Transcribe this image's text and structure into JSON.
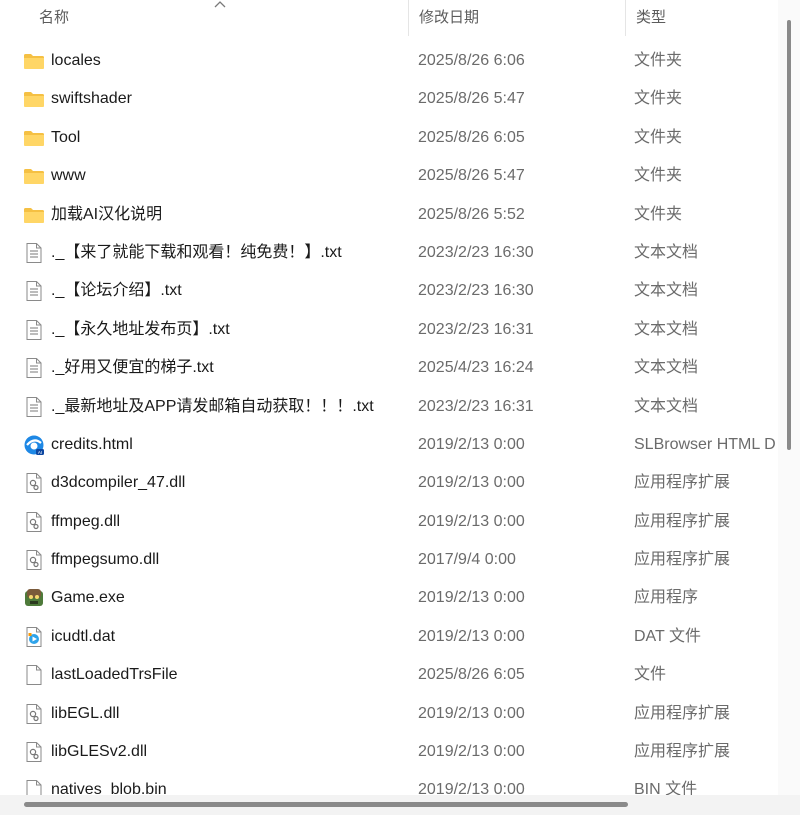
{
  "header": {
    "name_label": "名称",
    "date_label": "修改日期",
    "type_label": "类型"
  },
  "files": [
    {
      "name": "locales",
      "date": "2025/8/26 6:06",
      "type": "文件夹",
      "icon": "folder"
    },
    {
      "name": "swiftshader",
      "date": "2025/8/26 5:47",
      "type": "文件夹",
      "icon": "folder"
    },
    {
      "name": "Tool",
      "date": "2025/8/26 6:05",
      "type": "文件夹",
      "icon": "folder"
    },
    {
      "name": "www",
      "date": "2025/8/26 5:47",
      "type": "文件夹",
      "icon": "folder"
    },
    {
      "name": "加载AI汉化说明",
      "date": "2025/8/26 5:52",
      "type": "文件夹",
      "icon": "folder"
    },
    {
      "name": "._【来了就能下载和观看！纯免费！】.txt",
      "date": "2023/2/23 16:30",
      "type": "文本文档",
      "icon": "text"
    },
    {
      "name": "._【论坛介绍】.txt",
      "date": "2023/2/23 16:30",
      "type": "文本文档",
      "icon": "text"
    },
    {
      "name": "._【永久地址发布页】.txt",
      "date": "2023/2/23 16:31",
      "type": "文本文档",
      "icon": "text"
    },
    {
      "name": "._好用又便宜的梯子.txt",
      "date": "2025/4/23 16:24",
      "type": "文本文档",
      "icon": "text"
    },
    {
      "name": "._最新地址及APP请发邮箱自动获取！！！.txt",
      "date": "2023/2/23 16:31",
      "type": "文本文档",
      "icon": "text"
    },
    {
      "name": "credits.html",
      "date": "2019/2/13 0:00",
      "type": "SLBrowser HTML D",
      "icon": "browser"
    },
    {
      "name": "d3dcompiler_47.dll",
      "date": "2019/2/13 0:00",
      "type": "应用程序扩展",
      "icon": "dll"
    },
    {
      "name": "ffmpeg.dll",
      "date": "2019/2/13 0:00",
      "type": "应用程序扩展",
      "icon": "dll"
    },
    {
      "name": "ffmpegsumo.dll",
      "date": "2017/9/4 0:00",
      "type": "应用程序扩展",
      "icon": "dll"
    },
    {
      "name": "Game.exe",
      "date": "2019/2/13 0:00",
      "type": "应用程序",
      "icon": "exe"
    },
    {
      "name": "icudtl.dat",
      "date": "2019/2/13 0:00",
      "type": "DAT 文件",
      "icon": "media"
    },
    {
      "name": "lastLoadedTrsFile",
      "date": "2025/8/26 6:05",
      "type": "文件",
      "icon": "blank"
    },
    {
      "name": "libEGL.dll",
      "date": "2019/2/13 0:00",
      "type": "应用程序扩展",
      "icon": "dll"
    },
    {
      "name": "libGLESv2.dll",
      "date": "2019/2/13 0:00",
      "type": "应用程序扩展",
      "icon": "dll"
    },
    {
      "name": "natives_blob.bin",
      "date": "2019/2/13 0:00",
      "type": "BIN 文件",
      "icon": "blank"
    }
  ]
}
